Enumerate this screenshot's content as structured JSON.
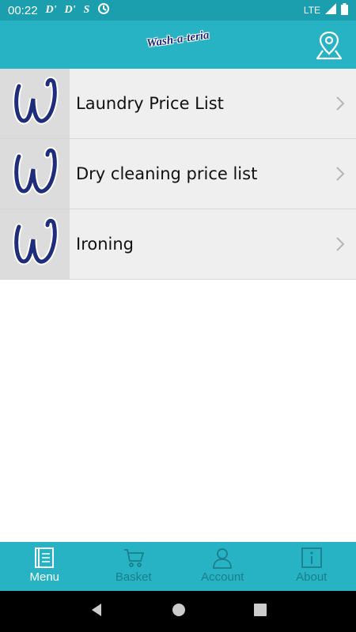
{
  "status_bar": {
    "time": "00:22",
    "notifications": [
      "D'",
      "D'",
      "S"
    ],
    "network": "LTE",
    "icons": [
      "sync-icon",
      "signal-icon",
      "battery-icon"
    ]
  },
  "header": {
    "logo_text": "Wash-a-teria",
    "location_icon": "map-pin-icon"
  },
  "menu_items": [
    {
      "label": "Laundry Price List",
      "icon": "w-logo-icon"
    },
    {
      "label": "Dry cleaning price list",
      "icon": "w-logo-icon"
    },
    {
      "label": "Ironing",
      "icon": "w-logo-icon"
    }
  ],
  "tab_bar": {
    "tabs": [
      {
        "label": "Menu",
        "icon": "book-icon",
        "active": true
      },
      {
        "label": "Basket",
        "icon": "cart-icon",
        "active": false
      },
      {
        "label": "Account",
        "icon": "person-icon",
        "active": false
      },
      {
        "label": "About",
        "icon": "info-icon",
        "active": false
      }
    ]
  },
  "colors": {
    "header": "#27b3c4",
    "status_bar": "#1b9fae",
    "logo": "#1f2d7a",
    "inactive_tab": "#1a7f8c"
  }
}
